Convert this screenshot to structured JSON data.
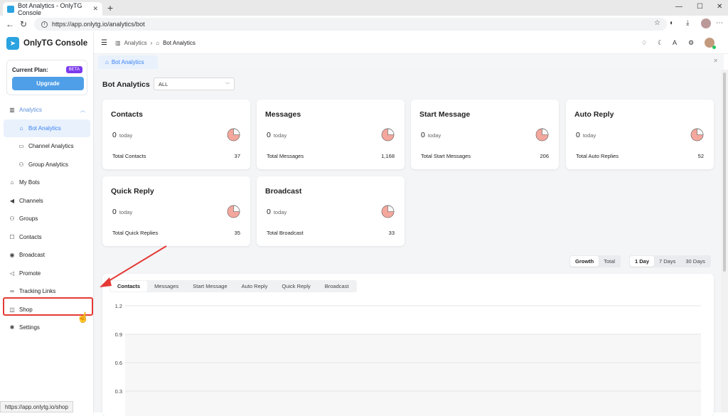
{
  "browser": {
    "tab_title": "Bot Analytics - OnlyTG Console",
    "url": "https://app.onlytg.io/analytics/bot",
    "status_url": "https://app.onlytg.io/shop"
  },
  "sidebar": {
    "brand": "OnlyTG Console",
    "plan_label": "Current Plan:",
    "plan_badge": "BETA",
    "upgrade_label": "Upgrade",
    "items": [
      {
        "label": "Analytics",
        "icon": "chart-icon"
      },
      {
        "label": "Bot Analytics",
        "icon": "bot-icon"
      },
      {
        "label": "Channel Analytics",
        "icon": "monitor-icon"
      },
      {
        "label": "Group Analytics",
        "icon": "group-icon"
      },
      {
        "label": "My Bots",
        "icon": "bot-icon"
      },
      {
        "label": "Channels",
        "icon": "megaphone-icon"
      },
      {
        "label": "Groups",
        "icon": "group-icon"
      },
      {
        "label": "Contacts",
        "icon": "contact-icon"
      },
      {
        "label": "Broadcast",
        "icon": "broadcast-icon"
      },
      {
        "label": "Promote",
        "icon": "promote-icon"
      },
      {
        "label": "Tracking Links",
        "icon": "link-icon"
      },
      {
        "label": "Shop",
        "icon": "bag-icon"
      },
      {
        "label": "Settings",
        "icon": "gear-icon"
      }
    ]
  },
  "header": {
    "breadcrumb_parent": "Analytics",
    "breadcrumb_current": "Bot Analytics"
  },
  "page_tab": "Bot Analytics",
  "main": {
    "title": "Bot Analytics",
    "filter_value": "ALL",
    "cards": [
      {
        "title": "Contacts",
        "today_value": "0",
        "today_label": "today",
        "total_label": "Total Contacts",
        "total_value": "37"
      },
      {
        "title": "Messages",
        "today_value": "0",
        "today_label": "today",
        "total_label": "Total Messages",
        "total_value": "1,168"
      },
      {
        "title": "Start Message",
        "today_value": "0",
        "today_label": "today",
        "total_label": "Total Start Messages",
        "total_value": "206"
      },
      {
        "title": "Auto Reply",
        "today_value": "0",
        "today_label": "today",
        "total_label": "Total Auto Replies",
        "total_value": "52"
      },
      {
        "title": "Quick Reply",
        "today_value": "0",
        "today_label": "today",
        "total_label": "Total Quick Replies",
        "total_value": "35"
      },
      {
        "title": "Broadcast",
        "today_value": "0",
        "today_label": "today",
        "total_label": "Total Broadcast",
        "total_value": "33"
      }
    ],
    "mode_toggle": [
      "Growth",
      "Total"
    ],
    "range_toggle": [
      "1 Day",
      "7 Days",
      "30 Days"
    ],
    "chart_tabs": [
      "Contacts",
      "Messages",
      "Start Message",
      "Auto Reply",
      "Quick Reply",
      "Broadcast"
    ]
  },
  "colors": {
    "accent": "#3b82f6",
    "pie": "#f4a79d",
    "annotation": "#e53935"
  },
  "chart_data": {
    "type": "line",
    "title": "",
    "xlabel": "",
    "ylabel": "",
    "y_ticks": [
      "1.2",
      "0.9",
      "0.6",
      "0.3"
    ],
    "ylim": [
      0,
      1.2
    ],
    "grid": true,
    "series": []
  }
}
